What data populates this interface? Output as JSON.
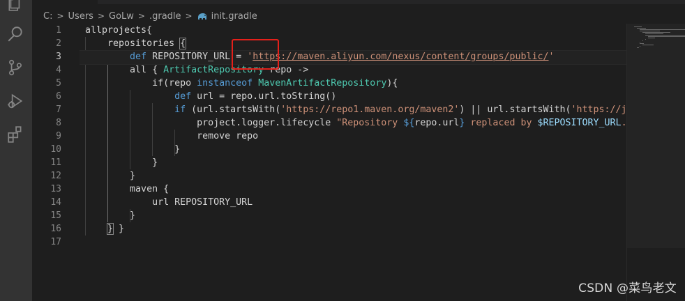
{
  "tab": {
    "label": "init.gradle"
  },
  "breadcrumb": {
    "items": [
      "C:",
      "Users",
      "GoLw",
      ".gradle",
      "init.gradle"
    ],
    "separator": ">"
  },
  "editor": {
    "current_line": 3,
    "line_numbers": [
      "1",
      "2",
      "3",
      "4",
      "5",
      "6",
      "7",
      "8",
      "9",
      "10",
      "11",
      "12",
      "13",
      "14",
      "15",
      "16",
      "17"
    ],
    "lines": [
      {
        "indent": "",
        "tokens": [
          {
            "t": "allprojects{",
            "c": "plain"
          }
        ]
      },
      {
        "indent": "    ",
        "tokens": [
          {
            "t": "repositories ",
            "c": "plain"
          },
          {
            "t": "{",
            "c": "plain",
            "hl": true
          }
        ]
      },
      {
        "indent": "        ",
        "tokens": [
          {
            "t": "def",
            "c": "kw"
          },
          {
            "t": " REPOSITORY_URL = ",
            "c": "plain"
          },
          {
            "t": "'",
            "c": "str"
          },
          {
            "t": "https://maven.aliyun.com/nexus/content/groups/public/",
            "c": "url"
          },
          {
            "t": "'",
            "c": "str"
          }
        ]
      },
      {
        "indent": "        ",
        "tokens": [
          {
            "t": "all { ",
            "c": "plain"
          },
          {
            "t": "ArtifactRepository",
            "c": "type"
          },
          {
            "t": " repo ->",
            "c": "plain"
          }
        ]
      },
      {
        "indent": "            ",
        "tokens": [
          {
            "t": "if(repo ",
            "c": "plain"
          },
          {
            "t": "instanceof",
            "c": "kw"
          },
          {
            "t": " ",
            "c": "plain"
          },
          {
            "t": "MavenArtifactRepository",
            "c": "type"
          },
          {
            "t": "){",
            "c": "plain"
          }
        ]
      },
      {
        "indent": "                ",
        "tokens": [
          {
            "t": "def",
            "c": "kw"
          },
          {
            "t": " url = repo.url.toString()",
            "c": "plain"
          }
        ]
      },
      {
        "indent": "                ",
        "tokens": [
          {
            "t": "if",
            "c": "kw"
          },
          {
            "t": " (url.startsWith(",
            "c": "plain"
          },
          {
            "t": "'https://repo1.maven.org/maven2'",
            "c": "str"
          },
          {
            "t": ") || url.startsWith(",
            "c": "plain"
          },
          {
            "t": "'https://jcenter.bintray.com/'",
            "c": "str"
          },
          {
            "t": ")) {",
            "c": "plain"
          }
        ]
      },
      {
        "indent": "                    ",
        "tokens": [
          {
            "t": "project.logger.lifecycle ",
            "c": "plain"
          },
          {
            "t": "\"Repository ",
            "c": "str"
          },
          {
            "t": "${",
            "c": "kw"
          },
          {
            "t": "repo.url",
            "c": "plain"
          },
          {
            "t": "}",
            "c": "kw"
          },
          {
            "t": " replaced by ",
            "c": "str"
          },
          {
            "t": "$REPOSITORY_URL",
            "c": "var"
          },
          {
            "t": ".\"",
            "c": "str"
          }
        ]
      },
      {
        "indent": "                    ",
        "tokens": [
          {
            "t": "remove repo",
            "c": "plain"
          }
        ]
      },
      {
        "indent": "                ",
        "tokens": [
          {
            "t": "}",
            "c": "plain"
          }
        ]
      },
      {
        "indent": "            ",
        "tokens": [
          {
            "t": "}",
            "c": "plain"
          }
        ]
      },
      {
        "indent": "        ",
        "tokens": [
          {
            "t": "}",
            "c": "plain"
          }
        ]
      },
      {
        "indent": "        ",
        "tokens": [
          {
            "t": "maven {",
            "c": "plain"
          }
        ]
      },
      {
        "indent": "            ",
        "tokens": [
          {
            "t": "url REPOSITORY_URL",
            "c": "plain"
          }
        ]
      },
      {
        "indent": "        ",
        "tokens": [
          {
            "t": "}",
            "c": "plain"
          }
        ]
      },
      {
        "indent": "    ",
        "tokens": [
          {
            "t": "}",
            "c": "plain",
            "hl": true
          },
          {
            "t": " }",
            "c": "plain"
          }
        ]
      },
      {
        "indent": "",
        "tokens": []
      }
    ]
  },
  "icons": {
    "activity_bar": [
      "files-icon",
      "search-icon",
      "source-control-icon",
      "run-debug-icon",
      "extensions-icon"
    ],
    "breadcrumb_file": "gradle-elephant-icon"
  },
  "colors": {
    "editor_bg": "#1e1e1e",
    "activity_bar_bg": "#333333",
    "keyword": "#569cd6",
    "type": "#4ec9b0",
    "string": "#ce9178",
    "variable": "#9cdcfe",
    "annotation_box": "#e5201a"
  },
  "watermark": {
    "text": "CSDN @菜鸟老文"
  }
}
